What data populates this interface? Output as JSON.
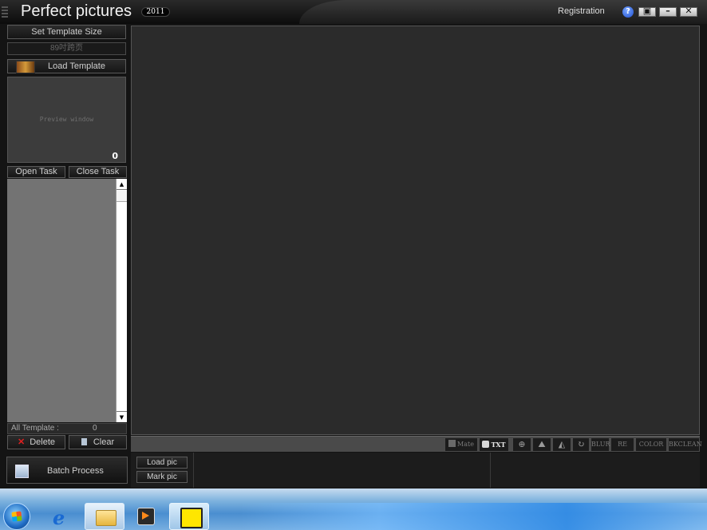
{
  "window": {
    "title": "Perfect pictures",
    "year_badge": "2011",
    "registration": "Registration",
    "help": "?",
    "restore": "▣",
    "minimize": "–",
    "close": "✕"
  },
  "left_panel": {
    "set_template_size": "Set Template Size",
    "template_size_value": "89吋跨页",
    "load_template": "Load Template",
    "preview_label": "Preview window",
    "preview_count": "0",
    "open_task": "Open Task",
    "close_task": "Close Task",
    "scroll_up": "▲",
    "scroll_down": "▼",
    "all_template_label": "All Template :",
    "all_template_count": "0",
    "delete": "Delete",
    "delete_icon": "✕",
    "clear": "Clear",
    "batch_process": "Batch Process"
  },
  "toolbar": {
    "mate": "Mate",
    "txt": "TXT",
    "zoom_icon": "⊕",
    "mountain_icon": "⛰",
    "flip_icon": "◭",
    "rotate_icon": "↻",
    "blur": "BLUR",
    "re": "RE",
    "color": "COLOR",
    "bkclean": "BKCLEAN"
  },
  "bottom": {
    "load_pic": "Load pic",
    "mark_pic": "Mark pic"
  },
  "taskbar": {
    "ie_glyph": "e"
  }
}
